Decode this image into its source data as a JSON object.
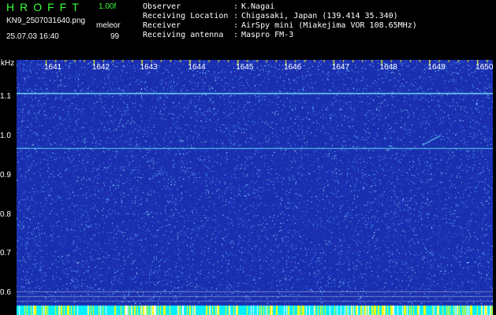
{
  "header": {
    "app_title": "HROFFT",
    "version": "1.00f",
    "filename": "KN9_2507031640.png",
    "datetime": "25.07.03 16:40",
    "mode": "meleor",
    "count": "99"
  },
  "info": [
    {
      "label": "Observer",
      "value": "K.Nagai"
    },
    {
      "label": "Receiving Location",
      "value": "Chigasaki, Japan (139.414 35.340)"
    },
    {
      "label": "Receiver",
      "value": "AirSpy mini (Miakejima VOR 108.65MHz)"
    },
    {
      "label": "Receiving antenna",
      "value": "Maspro FM-3"
    }
  ],
  "spectrogram": {
    "y_unit": "kHz",
    "y_ticks": [
      "1.1",
      "1.0",
      "0.9",
      "0.8",
      "0.7",
      "0.6"
    ],
    "x_ticks": [
      "1641",
      "1642",
      "1643",
      "1644",
      "1645",
      "1646",
      "1647",
      "1648",
      "1649",
      "1650"
    ],
    "colors": {
      "background": "#1a2fb0",
      "noise": "#4aa8ff",
      "signal": "#6ff5ff",
      "baseline": "#00f0ff",
      "tick_mark": "#ffff00"
    }
  }
}
